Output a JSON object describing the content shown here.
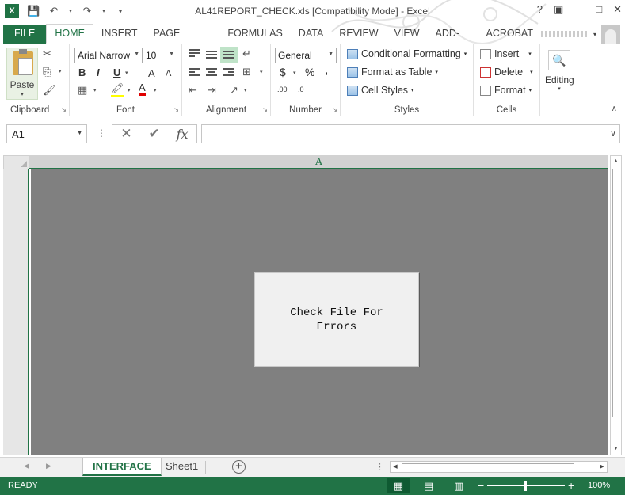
{
  "window": {
    "title": "AL41REPORT_CHECK.xls  [Compatibility Mode] - Excel",
    "help": "?",
    "logo": "X"
  },
  "tabs": [
    {
      "label": "FILE"
    },
    {
      "label": "HOME"
    },
    {
      "label": "INSERT"
    },
    {
      "label": "PAGE LAYOUT"
    },
    {
      "label": "FORMULAS"
    },
    {
      "label": "DATA"
    },
    {
      "label": "REVIEW"
    },
    {
      "label": "VIEW"
    },
    {
      "label": "ADD-INS"
    },
    {
      "label": "ACROBAT"
    }
  ],
  "ribbon": {
    "clipboard": {
      "label": "Clipboard",
      "paste": "Paste"
    },
    "font": {
      "label": "Font",
      "name": "Arial Narrow",
      "size": "10",
      "bold": "B",
      "italic": "I",
      "underline": "U",
      "grow": "A",
      "shrink": "A",
      "color": "A"
    },
    "alignment": {
      "label": "Alignment"
    },
    "number": {
      "label": "Number",
      "format": "General",
      "currency": "$",
      "percent": "%",
      "comma": ",",
      "inc_decimal": ".00",
      "dec_decimal": ".0"
    },
    "styles": {
      "label": "Styles",
      "conditional": "Conditional Formatting",
      "table": "Format as Table",
      "cell_styles": "Cell Styles"
    },
    "cells": {
      "label": "Cells",
      "insert": "Insert",
      "delete": "Delete",
      "format": "Format"
    },
    "editing": {
      "label": "Editing"
    }
  },
  "formula_bar": {
    "name_box": "A1",
    "fx": "fx",
    "value": ""
  },
  "sheet": {
    "column_header": "A",
    "macro_button": "Check File For Errors"
  },
  "sheet_tabs": [
    {
      "label": "INTERFACE",
      "active": true
    },
    {
      "label": "Sheet1",
      "active": false
    }
  ],
  "status": {
    "ready": "READY",
    "zoom": "100%"
  },
  "colors": {
    "accent": "#217346",
    "grid_background": "#808080"
  }
}
